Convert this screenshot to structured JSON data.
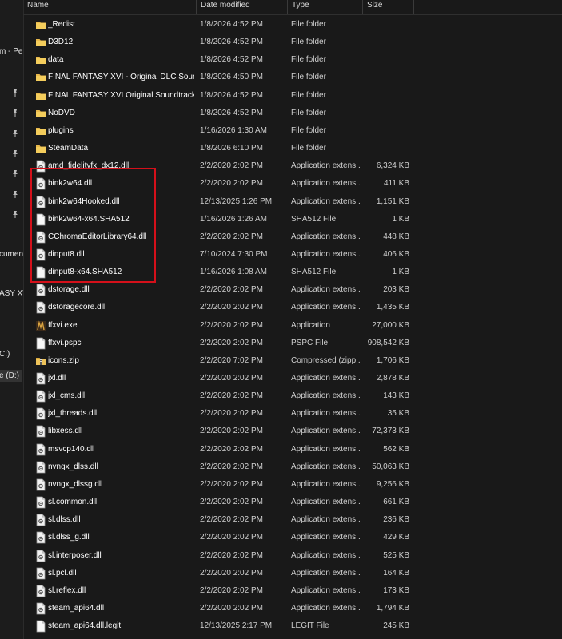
{
  "nav": {
    "labels": [
      "m - Pe",
      "cumen",
      "ASY XV",
      "C:)",
      "e (D:)"
    ],
    "pin_count": 7
  },
  "columns": {
    "name": "Name",
    "date": "Date modified",
    "type": "Type",
    "size": "Size"
  },
  "colors": {
    "highlight_border": "#d4101a",
    "folder": "#e8b84b"
  },
  "files": [
    {
      "name": "_Redist",
      "date": "1/8/2026 4:52 PM",
      "type": "File folder",
      "size": "",
      "icon": "folder"
    },
    {
      "name": "D3D12",
      "date": "1/8/2026 4:52 PM",
      "type": "File folder",
      "size": "",
      "icon": "folder"
    },
    {
      "name": "data",
      "date": "1/8/2026 4:52 PM",
      "type": "File folder",
      "size": "",
      "icon": "folder"
    },
    {
      "name": "FINAL FANTASY XVI - Original DLC Soun...",
      "date": "1/8/2026 4:50 PM",
      "type": "File folder",
      "size": "",
      "icon": "folder"
    },
    {
      "name": "FINAL FANTASY XVI Original Soundtrack",
      "date": "1/8/2026 4:52 PM",
      "type": "File folder",
      "size": "",
      "icon": "folder"
    },
    {
      "name": "NoDVD",
      "date": "1/8/2026 4:52 PM",
      "type": "File folder",
      "size": "",
      "icon": "folder"
    },
    {
      "name": "plugins",
      "date": "1/16/2026 1:30 AM",
      "type": "File folder",
      "size": "",
      "icon": "folder"
    },
    {
      "name": "SteamData",
      "date": "1/8/2026 6:10 PM",
      "type": "File folder",
      "size": "",
      "icon": "folder"
    },
    {
      "name": "amd_fidelityfx_dx12.dll",
      "date": "2/2/2020 2:02 PM",
      "type": "Application extens...",
      "size": "6,324 KB",
      "icon": "dll"
    },
    {
      "name": "bink2w64.dll",
      "date": "2/2/2020 2:02 PM",
      "type": "Application extens...",
      "size": "411 KB",
      "icon": "dll"
    },
    {
      "name": "bink2w64Hooked.dll",
      "date": "12/13/2025 1:26 PM",
      "type": "Application extens...",
      "size": "1,151 KB",
      "icon": "dll"
    },
    {
      "name": "bink2w64-x64.SHA512",
      "date": "1/16/2026 1:26 AM",
      "type": "SHA512 File",
      "size": "1 KB",
      "icon": "file"
    },
    {
      "name": "CChromaEditorLibrary64.dll",
      "date": "2/2/2020 2:02 PM",
      "type": "Application extens...",
      "size": "448 KB",
      "icon": "dll"
    },
    {
      "name": "dinput8.dll",
      "date": "7/10/2024 7:30 PM",
      "type": "Application extens...",
      "size": "406 KB",
      "icon": "dll"
    },
    {
      "name": "dinput8-x64.SHA512",
      "date": "1/16/2026 1:08 AM",
      "type": "SHA512 File",
      "size": "1 KB",
      "icon": "file"
    },
    {
      "name": "dstorage.dll",
      "date": "2/2/2020 2:02 PM",
      "type": "Application extens...",
      "size": "203 KB",
      "icon": "dll"
    },
    {
      "name": "dstoragecore.dll",
      "date": "2/2/2020 2:02 PM",
      "type": "Application extens...",
      "size": "1,435 KB",
      "icon": "dll"
    },
    {
      "name": "ffxvi.exe",
      "date": "2/2/2020 2:02 PM",
      "type": "Application",
      "size": "27,000 KB",
      "icon": "exe"
    },
    {
      "name": "ffxvi.pspc",
      "date": "2/2/2020 2:02 PM",
      "type": "PSPC File",
      "size": "908,542 KB",
      "icon": "file"
    },
    {
      "name": "icons.zip",
      "date": "2/2/2020 7:02 PM",
      "type": "Compressed (zipp...",
      "size": "1,706 KB",
      "icon": "zip"
    },
    {
      "name": "jxl.dll",
      "date": "2/2/2020 2:02 PM",
      "type": "Application extens...",
      "size": "2,878 KB",
      "icon": "dll"
    },
    {
      "name": "jxl_cms.dll",
      "date": "2/2/2020 2:02 PM",
      "type": "Application extens...",
      "size": "143 KB",
      "icon": "dll"
    },
    {
      "name": "jxl_threads.dll",
      "date": "2/2/2020 2:02 PM",
      "type": "Application extens...",
      "size": "35 KB",
      "icon": "dll"
    },
    {
      "name": "libxess.dll",
      "date": "2/2/2020 2:02 PM",
      "type": "Application extens...",
      "size": "72,373 KB",
      "icon": "dll"
    },
    {
      "name": "msvcp140.dll",
      "date": "2/2/2020 2:02 PM",
      "type": "Application extens...",
      "size": "562 KB",
      "icon": "dll"
    },
    {
      "name": "nvngx_dlss.dll",
      "date": "2/2/2020 2:02 PM",
      "type": "Application extens...",
      "size": "50,063 KB",
      "icon": "dll"
    },
    {
      "name": "nvngx_dlssg.dll",
      "date": "2/2/2020 2:02 PM",
      "type": "Application extens...",
      "size": "9,256 KB",
      "icon": "dll"
    },
    {
      "name": "sl.common.dll",
      "date": "2/2/2020 2:02 PM",
      "type": "Application extens...",
      "size": "661 KB",
      "icon": "dll"
    },
    {
      "name": "sl.dlss.dll",
      "date": "2/2/2020 2:02 PM",
      "type": "Application extens...",
      "size": "236 KB",
      "icon": "dll"
    },
    {
      "name": "sl.dlss_g.dll",
      "date": "2/2/2020 2:02 PM",
      "type": "Application extens...",
      "size": "429 KB",
      "icon": "dll"
    },
    {
      "name": "sl.interposer.dll",
      "date": "2/2/2020 2:02 PM",
      "type": "Application extens...",
      "size": "525 KB",
      "icon": "dll"
    },
    {
      "name": "sl.pcl.dll",
      "date": "2/2/2020 2:02 PM",
      "type": "Application extens...",
      "size": "164 KB",
      "icon": "dll"
    },
    {
      "name": "sl.reflex.dll",
      "date": "2/2/2020 2:02 PM",
      "type": "Application extens...",
      "size": "173 KB",
      "icon": "dll"
    },
    {
      "name": "steam_api64.dll",
      "date": "2/2/2020 2:02 PM",
      "type": "Application extens...",
      "size": "1,794 KB",
      "icon": "dll"
    },
    {
      "name": "steam_api64.dll.legit",
      "date": "12/13/2025 2:17 PM",
      "type": "LEGIT File",
      "size": "245 KB",
      "icon": "file"
    }
  ]
}
